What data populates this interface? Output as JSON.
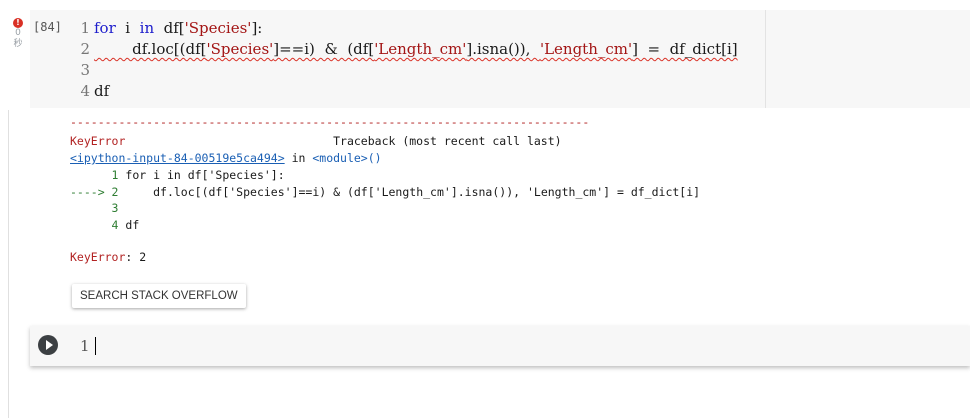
{
  "cell1": {
    "exec_count": "[84]",
    "status": {
      "error_icon": "!",
      "timer": "0\n秒"
    },
    "lines": [
      {
        "n": "1",
        "t": [
          {
            "c": "kw",
            "v": "for"
          },
          {
            "c": "",
            "v": "  i  "
          },
          {
            "c": "kw",
            "v": "in"
          },
          {
            "c": "",
            "v": "  df["
          },
          {
            "c": "str",
            "v": "'Species'"
          },
          {
            "c": "",
            "v": "]:"
          }
        ]
      },
      {
        "n": "2",
        "t": [
          {
            "c": "squig",
            "v": "        df.loc[(df["
          },
          {
            "c": "squig str",
            "v": "'Species'"
          },
          {
            "c": "squig",
            "v": "]==i)  &  (df["
          },
          {
            "c": "squig str",
            "v": "'Length_cm'"
          },
          {
            "c": "squig",
            "v": "].isna()),  "
          },
          {
            "c": "squig str",
            "v": "'Length_cm'"
          },
          {
            "c": "squig",
            "v": "]  =  df_dict[i]"
          }
        ]
      },
      {
        "n": "3",
        "t": []
      },
      {
        "n": "4",
        "t": [
          {
            "c": "",
            "v": "df"
          }
        ]
      }
    ]
  },
  "output": {
    "dashes": "---------------------------------------------------------------------------",
    "error_name": "KeyError",
    "traceback_label": "                              Traceback (most recent call last)",
    "input_link": "<ipython-input-84-00519e5ca494>",
    "in_text": " in ",
    "module": "<module>()",
    "tb_lines": [
      {
        "arrow": "      ",
        "n": "1",
        "code": " for i in df['Species']:"
      },
      {
        "arrow": "----> ",
        "n": "2",
        "code": "     df.loc[(df['Species']==i) & (df['Length_cm'].isna()), 'Length_cm'] = df_dict[i]"
      },
      {
        "arrow": "      ",
        "n": "3",
        "code": ""
      },
      {
        "arrow": "      ",
        "n": "4",
        "code": " df"
      }
    ],
    "final_error": "KeyError",
    "final_msg": ": 2",
    "search_button": "SEARCH STACK OVERFLOW"
  },
  "cell2": {
    "line_number": "1",
    "value": ""
  },
  "icons": {
    "run": "play-icon",
    "error": "error-icon"
  },
  "colors": {
    "error": "#d93025",
    "keyword": "#1d1dcc",
    "string": "#a31515",
    "link": "#1a5fb4"
  }
}
